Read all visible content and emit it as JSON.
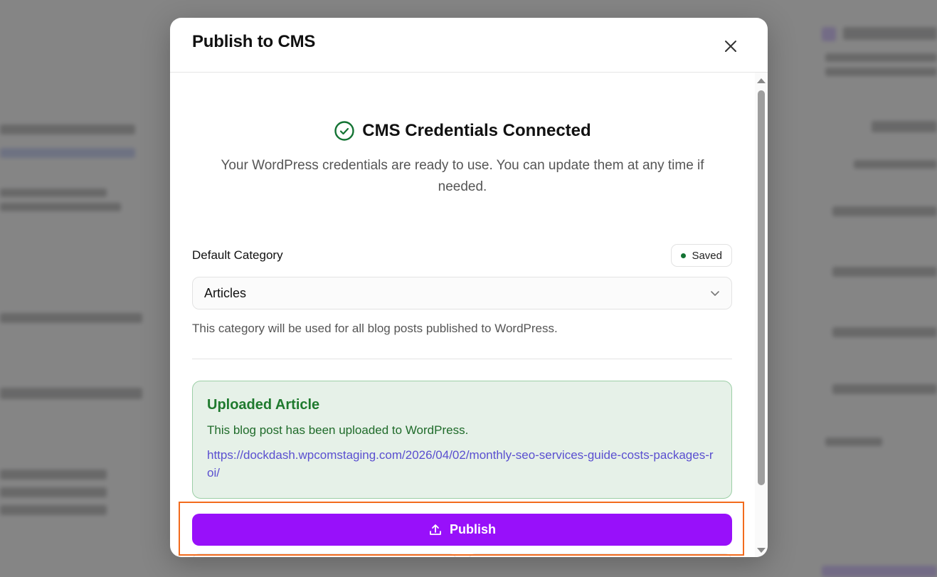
{
  "modal": {
    "title": "Publish to CMS",
    "close_icon": "close-icon"
  },
  "status": {
    "icon": "check-circle-icon",
    "title": "CMS Credentials Connected",
    "description": "Your WordPress credentials are ready to use. You can update them at any time if needed."
  },
  "category": {
    "label": "Default Category",
    "badge": "Saved",
    "selected": "Articles",
    "helper": "This category will be used for all blog posts published to WordPress."
  },
  "upload": {
    "title": "Uploaded Article",
    "text": "This blog post has been uploaded to WordPress.",
    "link": "https://dockdash.wpcomstaging.com/2026/04/02/monthly-seo-services-guide-costs-packages-roi/"
  },
  "publish": {
    "label": "Publish",
    "icon": "upload-icon"
  },
  "colors": {
    "accent": "#9810fa",
    "success": "#1f7a2e",
    "highlight": "#f26b1d"
  }
}
